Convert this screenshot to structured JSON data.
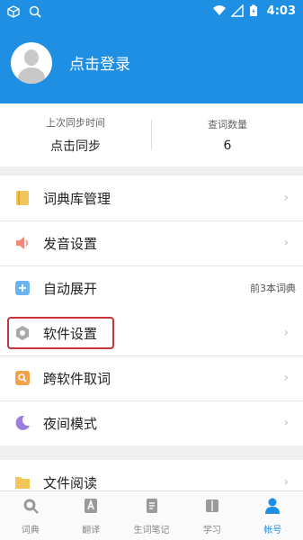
{
  "status_bar": {
    "time": "4:03",
    "battery": "60"
  },
  "profile": {
    "login_text": "点击登录"
  },
  "sync": {
    "last_sync_label": "上次同步时间",
    "last_sync_value": "点击同步",
    "lookup_count_label": "查词数量",
    "lookup_count_value": "6"
  },
  "menu_group_1": [
    {
      "label": "词典库管理",
      "icon": "book-icon",
      "extra": ""
    },
    {
      "label": "发音设置",
      "icon": "speaker-icon",
      "extra": ""
    },
    {
      "label": "自动展开",
      "icon": "plus-box-icon",
      "extra": "前3本词典"
    }
  ],
  "menu_group_2": [
    {
      "label": "软件设置",
      "icon": "hexagon-gear-icon",
      "extra": ""
    },
    {
      "label": "跨软件取词",
      "icon": "search-box-icon",
      "extra": ""
    },
    {
      "label": "夜间模式",
      "icon": "moon-icon",
      "extra": ""
    }
  ],
  "menu_group_3": [
    {
      "label": "文件阅读",
      "icon": "folder-icon",
      "extra": ""
    }
  ],
  "tabs": [
    {
      "label": "词典",
      "icon": "search-icon"
    },
    {
      "label": "翻译",
      "icon": "translate-icon"
    },
    {
      "label": "生词笔记",
      "icon": "notes-icon"
    },
    {
      "label": "学习",
      "icon": "study-icon"
    },
    {
      "label": "帐号",
      "icon": "account-icon",
      "active": true
    }
  ],
  "colors": {
    "accent": "#1e8fe3",
    "highlight": "#c8343a"
  }
}
